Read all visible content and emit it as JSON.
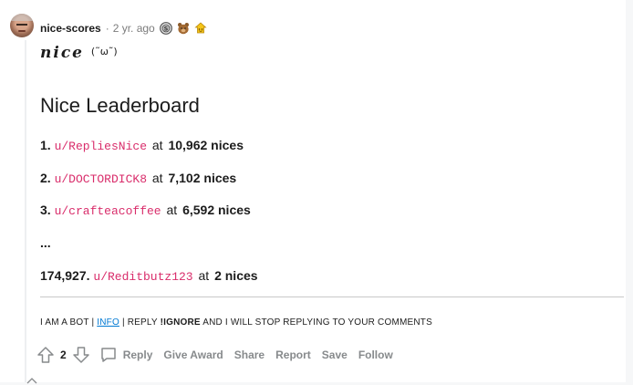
{
  "comment": {
    "author": "nice-scores",
    "time": "2 yr. ago",
    "awards": [
      "silver-award-icon",
      "bear-award-icon",
      "wholesome-award-icon"
    ],
    "title": {
      "text": "nice",
      "face": "(˜ω˜)"
    },
    "heading": "Nice Leaderboard",
    "leaderboard": [
      {
        "rank": "1.",
        "user": "u/RepliesNice",
        "at": "at",
        "score": "10,962 nices"
      },
      {
        "rank": "2.",
        "user": "u/DOCTORDICK8",
        "at": "at",
        "score": "7,102 nices"
      },
      {
        "rank": "3.",
        "user": "u/crafteacoffee",
        "at": "at",
        "score": "6,592 nices"
      }
    ],
    "ellipsis": "...",
    "self_rank": {
      "rank": "174,927.",
      "user": "u/Reditbutz123",
      "at": "at",
      "score": "2 nices"
    },
    "footer": {
      "prefix": "I AM A BOT |",
      "info": "INFO",
      "middle": "| REPLY",
      "ignore": "!IGNORE",
      "suffix": "AND I WILL STOP REPLYING TO YOUR COMMENTS"
    }
  },
  "actions": {
    "score": "2",
    "reply": "Reply",
    "give_award": "Give Award",
    "share": "Share",
    "report": "Report",
    "save": "Save",
    "follow": "Follow"
  }
}
